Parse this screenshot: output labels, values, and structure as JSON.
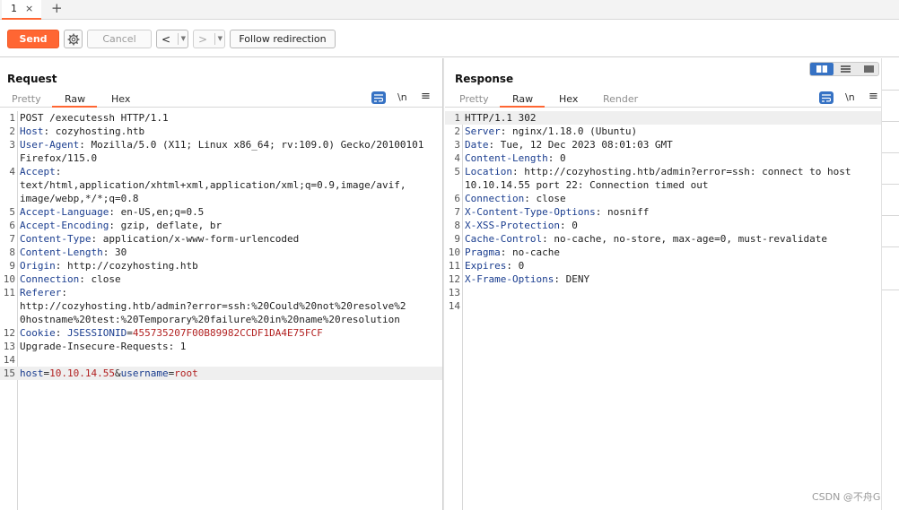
{
  "tabs": [
    {
      "label": "1",
      "close": "×"
    }
  ],
  "tab_add": "+",
  "toolbar": {
    "send": "Send",
    "cancel": "Cancel",
    "back": "<",
    "forward": ">",
    "dropdown": "▼",
    "follow_redirection": "Follow redirection"
  },
  "request": {
    "title": "Request",
    "tabs": [
      "Pretty",
      "Raw",
      "Hex"
    ],
    "active_tab": "Raw",
    "newline_icon": "\\n",
    "menu_icon": "≡",
    "lines": [
      {
        "n": "1",
        "key": "",
        "val": "POST /executessh HTTP/1.1"
      },
      {
        "n": "2",
        "key": "Host",
        "val": "cozyhosting.htb"
      },
      {
        "n": "3",
        "key": "User-Agent",
        "val": "Mozilla/5.0 (X11; Linux x86_64; rv:109.0) Gecko/20100101"
      },
      {
        "n": "",
        "key": "",
        "val": "Firefox/115.0"
      },
      {
        "n": "4",
        "key": "Accept",
        "val": ""
      },
      {
        "n": "",
        "key": "",
        "val": "text/html,application/xhtml+xml,application/xml;q=0.9,image/avif,"
      },
      {
        "n": "",
        "key": "",
        "val": "image/webp,*/*;q=0.8"
      },
      {
        "n": "5",
        "key": "Accept-Language",
        "val": "en-US,en;q=0.5"
      },
      {
        "n": "6",
        "key": "Accept-Encoding",
        "val": "gzip, deflate, br"
      },
      {
        "n": "7",
        "key": "Content-Type",
        "val": "application/x-www-form-urlencoded"
      },
      {
        "n": "8",
        "key": "Content-Length",
        "val": "30"
      },
      {
        "n": "9",
        "key": "Origin",
        "val": "http://cozyhosting.htb"
      },
      {
        "n": "10",
        "key": "Connection",
        "val": "close"
      },
      {
        "n": "11",
        "key": "Referer",
        "val": ""
      },
      {
        "n": "",
        "key": "",
        "val": "http://cozyhosting.htb/admin?error=ssh:%20Could%20not%20resolve%2"
      },
      {
        "n": "",
        "key": "",
        "val": "0hostname%20test:%20Temporary%20failure%20in%20name%20resolution"
      },
      {
        "n": "12",
        "key": "Cookie",
        "val": "JSESSIONID=455735207F00B89982CCDF1DA4E75FCF"
      },
      {
        "n": "13",
        "key": "",
        "val": "Upgrade-Insecure-Requests: 1"
      },
      {
        "n": "14",
        "key": "",
        "val": ""
      },
      {
        "n": "15",
        "key": "",
        "val": "host=10.10.14.55&username=root"
      }
    ]
  },
  "response": {
    "title": "Response",
    "tabs": [
      "Pretty",
      "Raw",
      "Hex",
      "Render"
    ],
    "active_tab": "Raw",
    "newline_icon": "\\n",
    "menu_icon": "≡",
    "lines": [
      {
        "n": "1",
        "key": "",
        "val": "HTTP/1.1 302"
      },
      {
        "n": "2",
        "key": "Server",
        "val": "nginx/1.18.0 (Ubuntu)"
      },
      {
        "n": "3",
        "key": "Date",
        "val": "Tue, 12 Dec 2023 08:01:03 GMT"
      },
      {
        "n": "4",
        "key": "Content-Length",
        "val": "0"
      },
      {
        "n": "5",
        "key": "Location",
        "val": "http://cozyhosting.htb/admin?error=ssh: connect to host"
      },
      {
        "n": "",
        "key": "",
        "val": "10.10.14.55 port 22: Connection timed out"
      },
      {
        "n": "6",
        "key": "Connection",
        "val": "close"
      },
      {
        "n": "7",
        "key": "X-Content-Type-Options",
        "val": "nosniff"
      },
      {
        "n": "8",
        "key": "X-XSS-Protection",
        "val": "0"
      },
      {
        "n": "9",
        "key": "Cache-Control",
        "val": "no-cache, no-store, max-age=0, must-revalidate"
      },
      {
        "n": "10",
        "key": "Pragma",
        "val": "no-cache"
      },
      {
        "n": "11",
        "key": "Expires",
        "val": "0"
      },
      {
        "n": "12",
        "key": "X-Frame-Options",
        "val": "DENY"
      },
      {
        "n": "13",
        "key": "",
        "val": ""
      },
      {
        "n": "14",
        "key": "",
        "val": ""
      }
    ]
  },
  "watermark": "CSDN @不舟G",
  "colors": {
    "accent": "#ff6633",
    "header_key": "#1a3d8f",
    "cookie_value": "#b22222",
    "toggle_active": "#3672c4"
  },
  "icons": [
    "settings-gear-icon",
    "wrap-lines-icon",
    "newline-icon",
    "menu-icon",
    "split-view-icon",
    "horizontal-view-icon",
    "single-view-icon"
  ]
}
